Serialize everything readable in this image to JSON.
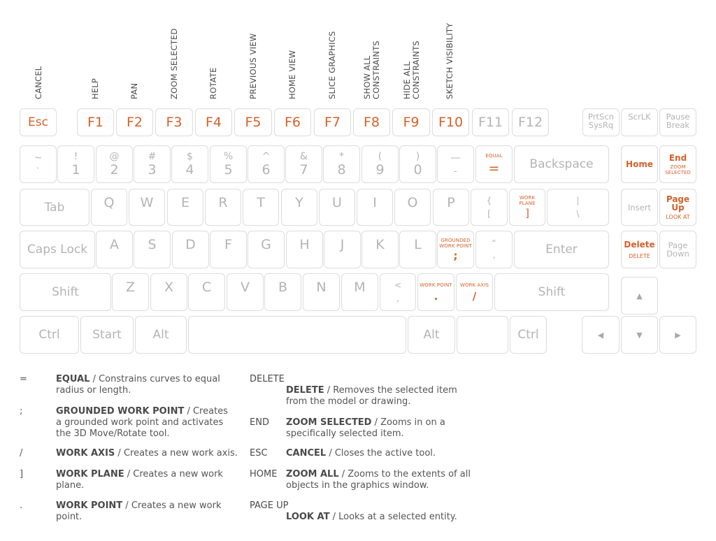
{
  "colors": {
    "accent": "#d4622a",
    "key_text": "#b4b4b4",
    "key_border": "#dcdcdc",
    "label_text": "#4a4a4a"
  },
  "function_labels": {
    "esc": [
      "CANCEL"
    ],
    "f1": [
      "HELP"
    ],
    "f2": [
      "PAN"
    ],
    "f3": [
      "ZOOM SELECTED"
    ],
    "f4": [
      "ROTATE"
    ],
    "f5": [
      "PREVIOUS VIEW"
    ],
    "f6": [
      "HOME VIEW"
    ],
    "f7": [
      "SLICE GRAPHICS"
    ],
    "f8": [
      "SHOW ALL",
      "CONSTRAINTS"
    ],
    "f9": [
      "HIDE ALL",
      "CONSTRAINTS"
    ],
    "f10": [
      "SKETCH VISIBILITY"
    ]
  },
  "keys": {
    "esc": "Esc",
    "f1": "F1",
    "f2": "F2",
    "f3": "F3",
    "f4": "F4",
    "f5": "F5",
    "f6": "F6",
    "f7": "F7",
    "f8": "F8",
    "f9": "F9",
    "f10": "F10",
    "f11": "F11",
    "f12": "F12",
    "prtscn": [
      "PrtScn",
      "SysRq"
    ],
    "scrlk": "ScrLK",
    "pause": [
      "Pause",
      "Break"
    ],
    "number_row": [
      {
        "top": "~",
        "bot": "`"
      },
      {
        "top": "!",
        "bot": "1"
      },
      {
        "top": "@",
        "bot": "2"
      },
      {
        "top": "#",
        "bot": "3"
      },
      {
        "top": "$",
        "bot": "4"
      },
      {
        "top": "%",
        "bot": "5"
      },
      {
        "top": "^",
        "bot": "6"
      },
      {
        "top": "&",
        "bot": "7"
      },
      {
        "top": "*",
        "bot": "8"
      },
      {
        "top": "(",
        "bot": "9"
      },
      {
        "top": ")",
        "bot": "0"
      },
      {
        "top": "—",
        "bot": "-"
      }
    ],
    "equal": {
      "label": "EQUAL",
      "char": "="
    },
    "backspace": "Backspace",
    "home": "Home",
    "end": {
      "label": "End",
      "sub": [
        "ZOOM",
        "SELECTED"
      ]
    },
    "tab": "Tab",
    "qwerty": [
      "Q",
      "W",
      "E",
      "R",
      "T",
      "Y",
      "U",
      "I",
      "O",
      "P"
    ],
    "lbracket": {
      "top": "{",
      "bot": "["
    },
    "rbracket": {
      "label": [
        "WORK",
        "PLANE"
      ],
      "char": "]"
    },
    "backslash": {
      "top": "|",
      "bot": "\\"
    },
    "insert": "Insert",
    "pageup": {
      "label": [
        "Page",
        "Up"
      ],
      "sub": "LOOK AT"
    },
    "capslock": "Caps Lock",
    "asdf": [
      "A",
      "S",
      "D",
      "F",
      "G",
      "H",
      "J",
      "K",
      "L"
    ],
    "semicolon": {
      "label": [
        "GROUNDED",
        "WORK POINT"
      ],
      "char": ";"
    },
    "quote": {
      "top": "“",
      "bot": ","
    },
    "enter": "Enter",
    "delete": {
      "label": "Delete",
      "sub": "DELETE"
    },
    "pagedown": [
      "Page",
      "Down"
    ],
    "shift_left": "Shift",
    "zxcv": [
      "Z",
      "X",
      "C",
      "V",
      "B",
      "N",
      "M"
    ],
    "comma": {
      "top": "<",
      "bot": ","
    },
    "period": {
      "label": "WORK POINT",
      "char": "."
    },
    "slash": {
      "label": "WORK AXIS",
      "char": "/"
    },
    "shift_right": "Shift",
    "ctrl_left": "Ctrl",
    "start": "Start",
    "alt_left": "Alt",
    "alt_right": "Alt",
    "ctrl_right": "Ctrl",
    "arrows": {
      "up": "▲",
      "left": "◀",
      "down": "▼",
      "right": "▶"
    }
  },
  "legend_left": [
    {
      "symbol": "=",
      "name": "EQUAL",
      "desc": " / Constrains curves to equal radius or length."
    },
    {
      "symbol": ";",
      "name": "GROUNDED WORK POINT",
      "desc": " / Creates a grounded work point and activates the 3D Move/Rotate tool."
    },
    {
      "symbol": "/",
      "name": "WORK AXIS",
      "desc": " / Creates a new work axis."
    },
    {
      "symbol": "]",
      "name": "WORK PLANE",
      "desc": " / Creates a new work plane."
    },
    {
      "symbol": ".",
      "name": "WORK POINT",
      "desc": " / Creates a new work point."
    }
  ],
  "legend_right": [
    {
      "key": "DELETE",
      "name": "DELETE",
      "desc": " / Removes the selected item from the model or drawing."
    },
    {
      "key": "END",
      "name": "ZOOM SELECTED",
      "desc": " / Zooms in on a specifically selected item."
    },
    {
      "key": "ESC",
      "name": "CANCEL",
      "desc": " / Closes the active tool."
    },
    {
      "key": "HOME",
      "name": "ZOOM ALL",
      "desc": " / Zooms to the extents of all objects in the graphics window."
    },
    {
      "key": "PAGE UP",
      "name": "LOOK AT",
      "desc": " / Looks at a selected entity."
    }
  ]
}
